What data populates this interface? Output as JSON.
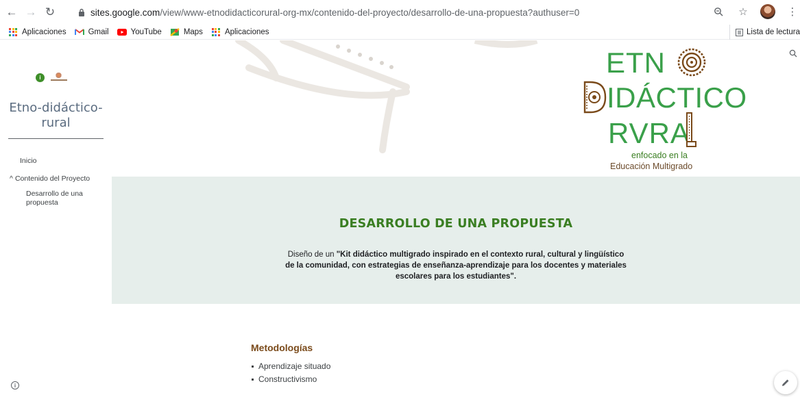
{
  "browser": {
    "url_host": "sites.google.com",
    "url_path": "/view/www-etnodidacticorural-org-mx/contenido-del-proyecto/desarrollo-de-una-propuesta?authuser=0"
  },
  "bookmarks": {
    "items": [
      "Aplicaciones",
      "Gmail",
      "YouTube",
      "Maps",
      "Aplicaciones"
    ],
    "reading_list": "Lista de lectura"
  },
  "sidebar": {
    "site_title": "Etno-didáctico-rural",
    "nav": {
      "inicio": "Inicio",
      "contenido": "Contenido del Proyecto",
      "desarrollo": "Desarrollo de una propuesta"
    }
  },
  "logo": {
    "line1": "ETN",
    "line2": "IDÁCTICO",
    "line3": "RVRA",
    "tag1": "enfocado en la",
    "tag2": "Educación Multigrado"
  },
  "band": {
    "title": "DESARROLLO DE UNA PROPUESTA",
    "lead": "Diseño de un ",
    "bold": "\"Kit didáctico multigrado inspirado en el contexto rural, cultural y lingüístico de la comunidad, con estrategias de enseñanza-aprendizaje para los docentes y materiales escolares para los estudiantes\"."
  },
  "metodologias": {
    "title": "Metodologías",
    "items": [
      "Aprendizaje situado",
      "Constructivismo"
    ]
  },
  "colors": {
    "band_bg": "#e6eeeb",
    "title_green": "#3a7e22",
    "heading_brown": "#7a4a1a",
    "logo_green": "#3aa04a"
  }
}
